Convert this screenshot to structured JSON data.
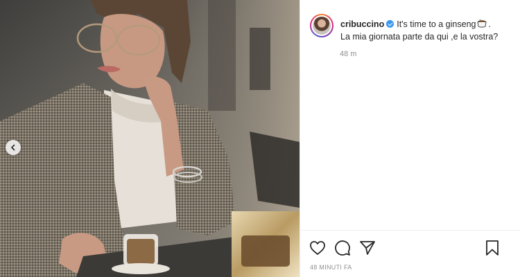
{
  "post": {
    "username": "cribuccino",
    "verified": true,
    "caption_line1": "It's time to a ginseng",
    "caption_line1_end": ".",
    "caption_line2": "La mia giornata parte da qui ,e la vostra?",
    "time_ago": "48 m",
    "date_label": "48 MINUTI FA"
  },
  "icons": {
    "carousel_prev": "chevron-left-icon",
    "like": "heart-icon",
    "comment": "comment-icon",
    "share": "paper-plane-icon",
    "save": "bookmark-icon",
    "verified": "verified-badge-icon",
    "caption_emoji": "coffee-cup-emoji"
  },
  "colors": {
    "text": "#262626",
    "muted": "#8e8e8e",
    "verified_blue": "#3897f0",
    "divider": "#efefef"
  }
}
